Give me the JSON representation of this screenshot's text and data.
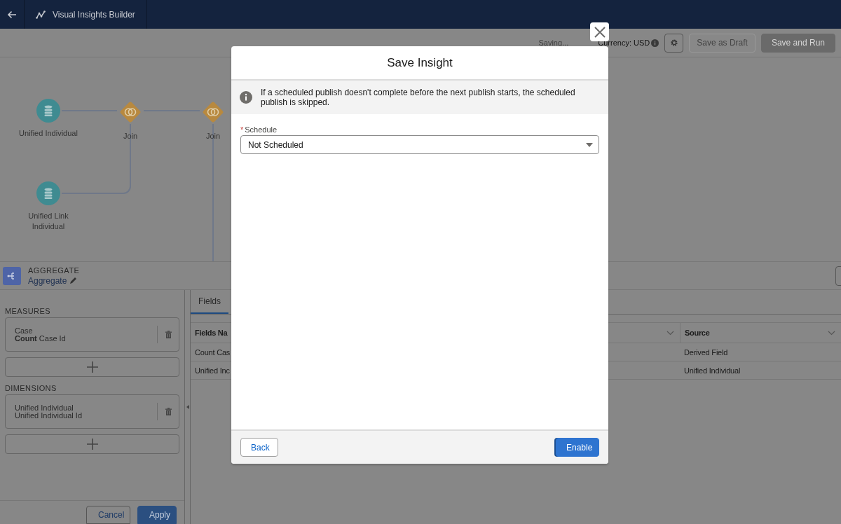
{
  "header": {
    "title": "Visual Insights Builder"
  },
  "toolbar": {
    "status": "Saving...",
    "currency": "Currency: USD",
    "buttons": [
      {
        "label": "Save as Draft",
        "kind": "outline",
        "disabled": true
      },
      {
        "label": "Save and Run",
        "kind": "brand",
        "disabled": true
      }
    ]
  },
  "canvas": {
    "nodes": [
      {
        "kind": "source",
        "label": "Unified Individual"
      },
      {
        "kind": "join",
        "label": "Join"
      },
      {
        "kind": "join",
        "label": "Join"
      },
      {
        "kind": "source",
        "label": "Unified Link Individual"
      }
    ]
  },
  "node_panel": {
    "type": "AGGREGATE",
    "name": "Aggregate"
  },
  "measures": {
    "title": "MEASURES",
    "items": [
      {
        "line1": "Case",
        "line2": "**Count** Case Id"
      }
    ]
  },
  "dimensions": {
    "title": "DIMENSIONS",
    "items": [
      {
        "line1": "Unified Individual",
        "line2": "Unified Individual Id"
      }
    ]
  },
  "panel_buttons": [
    {
      "label": "Cancel",
      "kind": "neutral"
    },
    {
      "label": "Apply",
      "kind": "brand"
    }
  ],
  "tabs": [
    {
      "label": "Fields",
      "selected": true
    }
  ],
  "table": {
    "columns": [
      {
        "label": "Fields Na"
      },
      {
        "label": "Source"
      }
    ],
    "rows": [
      [
        "Count Cas",
        "Derived Field"
      ],
      [
        "Unified Inc",
        "Unified Individual"
      ]
    ]
  },
  "modal": {
    "title": "Save Insight",
    "notice": "If a scheduled publish doesn't complete before the next publish starts, the scheduled publish is skipped.",
    "schedule": {
      "required_mark": "*",
      "label": "Schedule",
      "value": "Not Scheduled"
    },
    "buttons": [
      {
        "label": "Back",
        "kind": "neutral"
      },
      {
        "label": "Enable",
        "kind": "brand"
      }
    ]
  }
}
